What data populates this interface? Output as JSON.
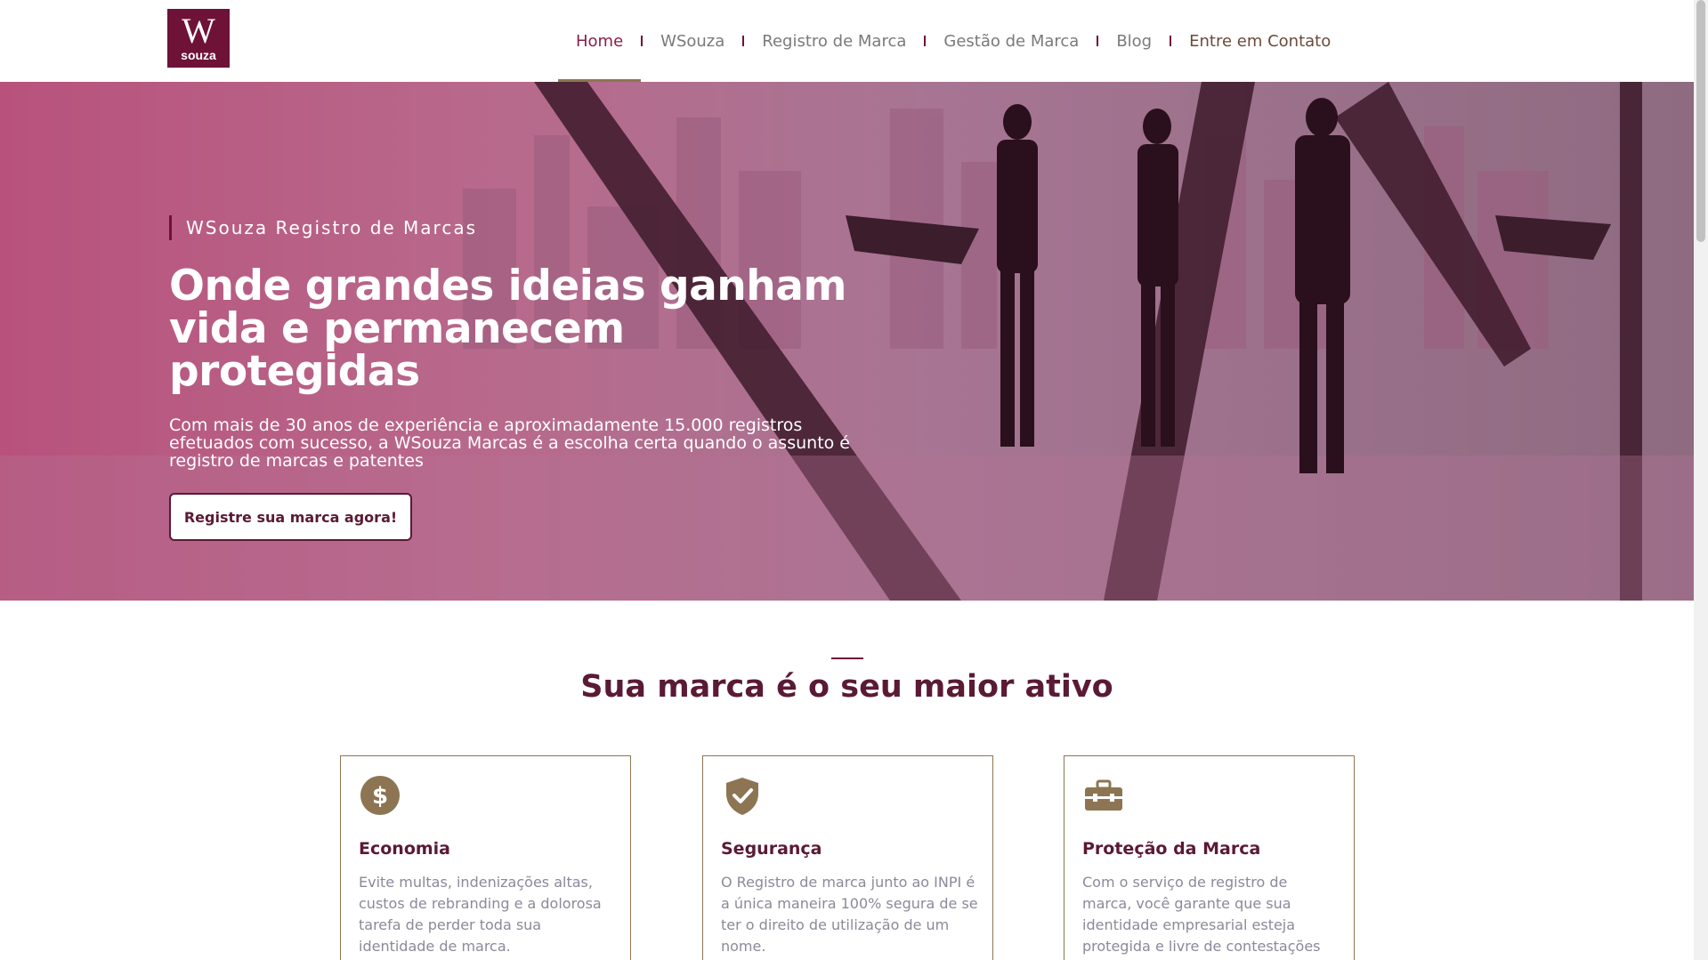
{
  "brand": {
    "logo_letter": "W",
    "logo_text": "souza",
    "color": "#6e1238"
  },
  "nav": {
    "items": [
      {
        "label": "Home",
        "active": true
      },
      {
        "label": "WSouza"
      },
      {
        "label": "Registro de Marca"
      },
      {
        "label": "Gestão de Marca"
      },
      {
        "label": "Blog"
      },
      {
        "label": "Entre em Contato"
      }
    ]
  },
  "hero": {
    "kicker": "WSouza Registro de Marcas",
    "title_line1": "Onde grandes ideias ganham",
    "title_line2": "vida e permanecem protegidas",
    "description": "Com mais de 30 anos de experiência e aproximadamente 15.000 registros efetuados com sucesso, a WSouza Marcas é a escolha certa quando o assunto é registro de marcas e patentes",
    "cta_label": "Registre sua marca agora!"
  },
  "section": {
    "title": "Sua marca é o seu maior ativo"
  },
  "cards": [
    {
      "icon": "dollar-circle-icon",
      "title": "Economia",
      "text": "Evite multas, indenizações altas, custos de rebranding e a dolorosa tarefa de perder toda sua identidade de marca."
    },
    {
      "icon": "shield-check-icon",
      "title": "Segurança",
      "text": "O Registro de marca junto ao INPI é a única maneira 100% segura de se ter o direito de utilização de um nome."
    },
    {
      "icon": "briefcase-icon",
      "title": "Proteção da Marca",
      "text": "Com o serviço de registro de marca, você garante que sua identidade empresarial esteja protegida e livre de contestações"
    }
  ],
  "colors": {
    "accent": "#6e1238",
    "gold": "#8d7553",
    "text_gray": "#8a8a9a"
  }
}
